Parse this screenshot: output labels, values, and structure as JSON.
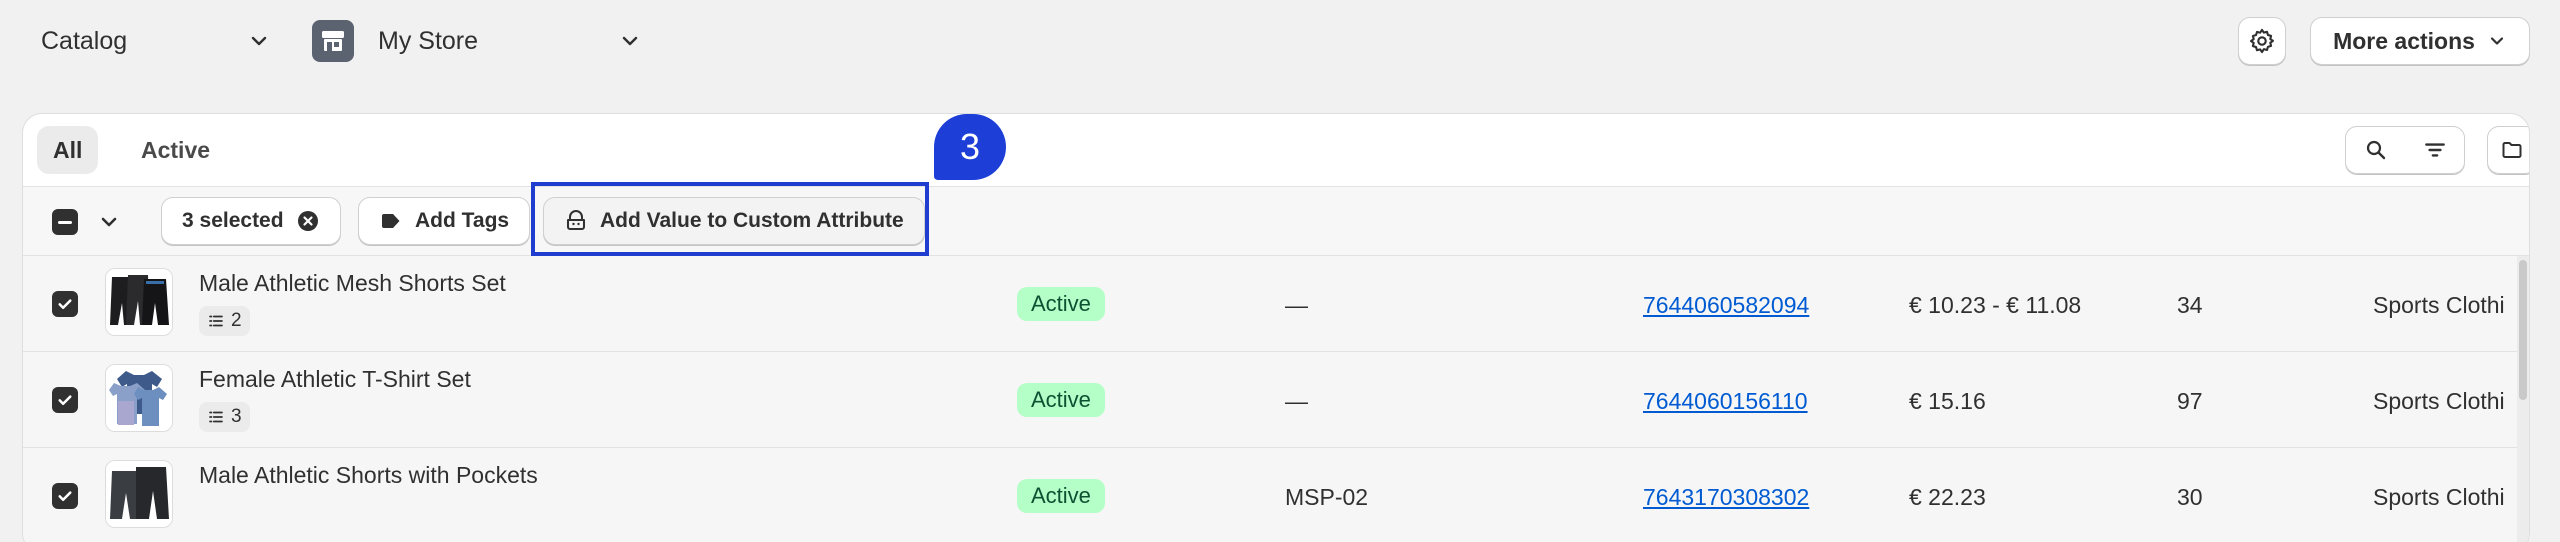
{
  "topbar": {
    "catalog_label": "Catalog",
    "store_label": "My Store",
    "more_actions_label": "More actions"
  },
  "tabs": [
    {
      "label": "All",
      "selected": true
    },
    {
      "label": "Active",
      "selected": false
    }
  ],
  "bulk": {
    "selected_label": "3 selected",
    "add_tags_label": "Add Tags",
    "add_value_label": "Add Value to Custom Attribute"
  },
  "step": {
    "number": "3"
  },
  "colors": {
    "highlight": "#1f3ed0",
    "badge": "#1d3fd8",
    "link": "#005bd3",
    "status_bg": "#b4fec7"
  },
  "rows": [
    {
      "title": "Male Athletic Mesh Shorts Set",
      "variants": "2",
      "status": "Active",
      "sku": "—",
      "product_id": "7644060582094",
      "price": "€ 10.23 - € 11.08",
      "quantity": "34",
      "category": "Sports Clothi",
      "checked": true
    },
    {
      "title": "Female Athletic T-Shirt Set",
      "variants": "3",
      "status": "Active",
      "sku": "—",
      "product_id": "7644060156110",
      "price": "€ 15.16",
      "quantity": "97",
      "category": "Sports Clothi",
      "checked": true
    },
    {
      "title": "Male Athletic Shorts with Pockets",
      "variants": "",
      "status": "Active",
      "sku": "MSP-02",
      "product_id": "7643170308302",
      "price": "€ 22.23",
      "quantity": "30",
      "category": "Sports Clothi",
      "checked": true
    }
  ]
}
